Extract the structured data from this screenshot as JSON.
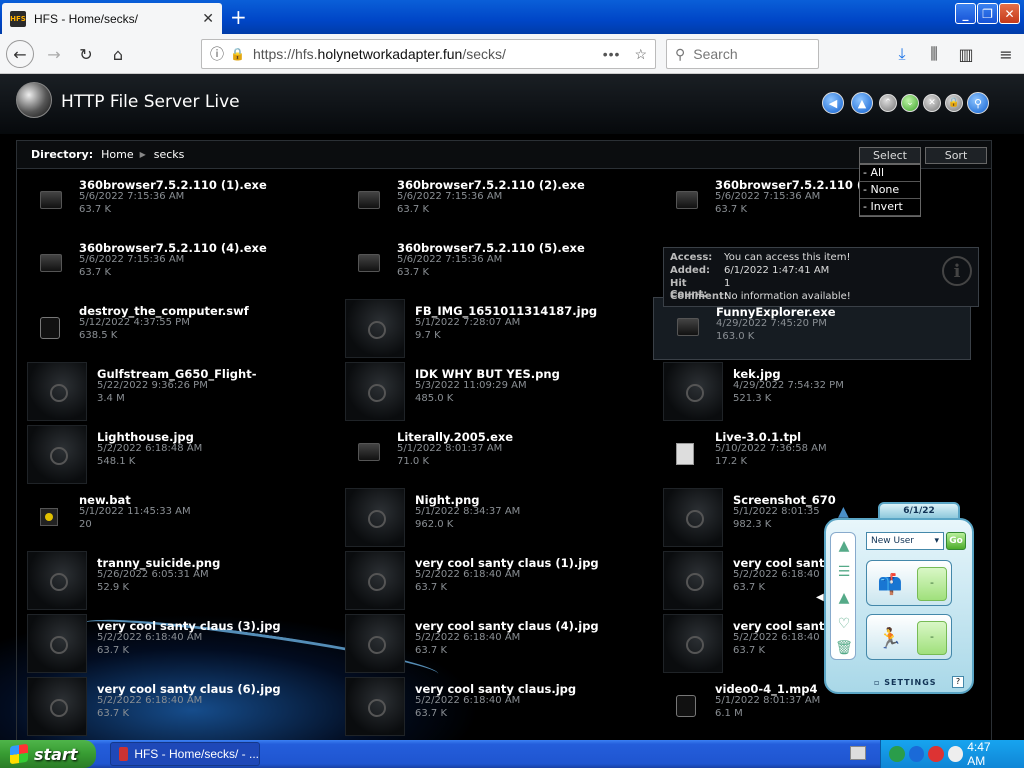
{
  "browser": {
    "tab_title": "HFS - Home/secks/",
    "url_prefix": "https://hfs.",
    "url_host": "holynetworkadapter.fun",
    "url_path": "/secks/",
    "search_placeholder": "Search"
  },
  "hfs": {
    "title": "HTTP File Server Live",
    "directory_label": "Directory:",
    "crumbs": [
      "Home",
      "secks"
    ],
    "select_label": "Select",
    "sort_label": "Sort",
    "select_options": [
      "- All",
      "- None",
      "- Invert"
    ]
  },
  "files": [
    {
      "name": "360browser7.5.2.110 (1).exe",
      "date": "5/6/2022 7:15:36 AM",
      "size": "63.7 K",
      "kind": "folder"
    },
    {
      "name": "360browser7.5.2.110 (2).exe",
      "date": "5/6/2022 7:15:36 AM",
      "size": "63.7 K",
      "kind": "folder"
    },
    {
      "name": "360browser7.5.2.110 (3).exe",
      "date": "5/6/2022 7:15:36 AM",
      "size": "63.7 K",
      "kind": "folder"
    },
    {
      "name": "360browser7.5.2.110 (4).exe",
      "date": "5/6/2022 7:15:36 AM",
      "size": "63.7 K",
      "kind": "folder"
    },
    {
      "name": "360browser7.5.2.110 (5).exe",
      "date": "5/6/2022 7:15:36 AM",
      "size": "63.7 K",
      "kind": "folder"
    },
    {
      "name": "",
      "date": "",
      "size": "",
      "kind": "none"
    },
    {
      "name": "destroy_the_computer.swf",
      "date": "5/12/2022 4:37:55 PM",
      "size": "638.5 K",
      "kind": "swf"
    },
    {
      "name": "FB_IMG_1651011314187.jpg",
      "date": "5/1/2022 7:28:07 AM",
      "size": "9.7 K",
      "kind": "thumb"
    },
    {
      "name": "FunnyExplorer.exe",
      "date": "4/29/2022 7:45:20 PM",
      "size": "163.0 K",
      "kind": "folder"
    },
    {
      "name": "Gulfstream_G650_Flight-",
      "date": "5/22/2022 9:36:26 PM",
      "size": "3.4 M",
      "kind": "thumb"
    },
    {
      "name": "IDK WHY BUT YES.png",
      "date": "5/3/2022 11:09:29 AM",
      "size": "485.0 K",
      "kind": "thumb"
    },
    {
      "name": "kek.jpg",
      "date": "4/29/2022 7:54:32 PM",
      "size": "521.3 K",
      "kind": "thumb"
    },
    {
      "name": "Lighthouse.jpg",
      "date": "5/2/2022 6:18:48 AM",
      "size": "548.1 K",
      "kind": "thumb"
    },
    {
      "name": "Literally.2005.exe",
      "date": "5/1/2022 8:01:37 AM",
      "size": "71.0 K",
      "kind": "folder"
    },
    {
      "name": "Live-3.0.1.tpl",
      "date": "5/10/2022 7:36:58 AM",
      "size": "17.2 K",
      "kind": "tpl"
    },
    {
      "name": "new.bat",
      "date": "5/1/2022 11:45:33 AM",
      "size": "20",
      "kind": "bat"
    },
    {
      "name": "Night.png",
      "date": "5/1/2022 8:34:37 AM",
      "size": "962.0 K",
      "kind": "thumb"
    },
    {
      "name": "Screenshot_670",
      "date": "5/1/2022 8:01:35",
      "size": "982.3 K",
      "kind": "thumb"
    },
    {
      "name": "tranny_suicide.png",
      "date": "5/26/2022 6:05:31 AM",
      "size": "52.9 K",
      "kind": "thumb"
    },
    {
      "name": "very cool santy claus (1).jpg",
      "date": "5/2/2022 6:18:40 AM",
      "size": "63.7 K",
      "kind": "thumb"
    },
    {
      "name": "very cool santy",
      "date": "5/2/2022 6:18:40",
      "size": "63.7 K",
      "kind": "thumb"
    },
    {
      "name": "very cool santy claus (3).jpg",
      "date": "5/2/2022 6:18:40 AM",
      "size": "63.7 K",
      "kind": "thumb"
    },
    {
      "name": "very cool santy claus (4).jpg",
      "date": "5/2/2022 6:18:40 AM",
      "size": "63.7 K",
      "kind": "thumb"
    },
    {
      "name": "very cool santy",
      "date": "5/2/2022 6:18:40",
      "size": "63.7 K",
      "kind": "thumb"
    },
    {
      "name": "very cool santy claus (6).jpg",
      "date": "5/2/2022 6:18:40 AM",
      "size": "63.7 K",
      "kind": "thumb"
    },
    {
      "name": "very cool santy claus.jpg",
      "date": "5/2/2022 6:18:40 AM",
      "size": "63.7 K",
      "kind": "thumb"
    },
    {
      "name": "video0-4_1.mp4",
      "date": "5/1/2022 8:01:37 AM",
      "size": "6.1 M",
      "kind": "mp4"
    }
  ],
  "info": {
    "access_label": "Access:",
    "access": "You can access this item!",
    "added_label": "Added:",
    "added": "6/1/2022 1:47:41 AM",
    "hits_label": "Hit Count:",
    "hits": "1",
    "comment_label": "Comment:",
    "comment": "No information available!"
  },
  "aim": {
    "date": "6/1/22",
    "user": "New User",
    "go": "Go",
    "dash1": "-",
    "dash2": "-",
    "settings": "SETTINGS",
    "help": "?"
  },
  "taskbar": {
    "start": "start",
    "task": "HFS - Home/secks/ - ...",
    "clock": "4:47 AM"
  }
}
